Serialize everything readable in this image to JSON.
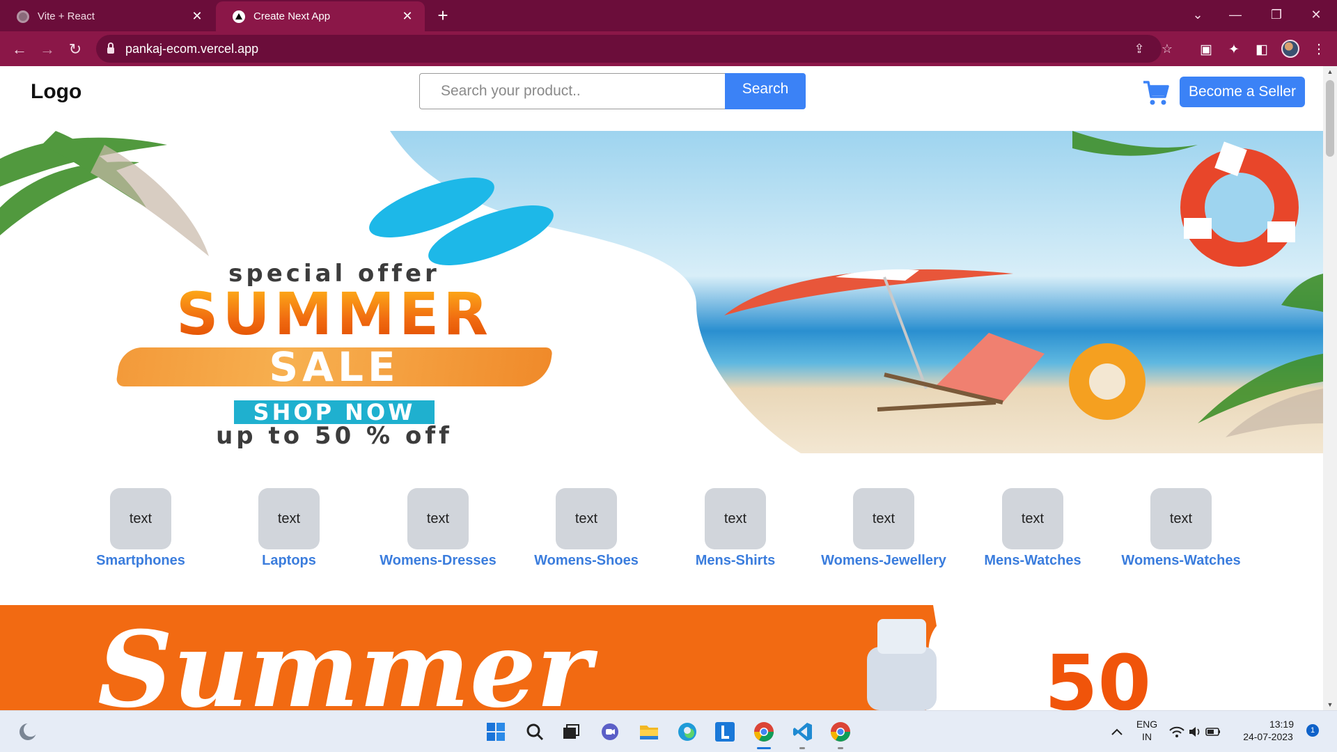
{
  "browser": {
    "tabs": [
      {
        "title": "Vite + React",
        "active": false
      },
      {
        "title": "Create Next App",
        "active": true
      }
    ],
    "url": "pankaj-ecom.vercel.app",
    "accent": "#8b1748"
  },
  "site": {
    "logo": "Logo",
    "search": {
      "placeholder": "Search your product..",
      "value": "",
      "button": "Search"
    },
    "seller_button": "Become a Seller",
    "hero": {
      "line1": "special offer",
      "line2": "SUMMER",
      "line3": "SALE",
      "cta": "SHOP NOW",
      "line4": "up to 50 % off"
    },
    "categories": [
      {
        "box": "text",
        "label": "Smartphones"
      },
      {
        "box": "text",
        "label": "Laptops"
      },
      {
        "box": "text",
        "label": "Womens-Dresses"
      },
      {
        "box": "text",
        "label": "Womens-Shoes"
      },
      {
        "box": "text",
        "label": "Mens-Shirts"
      },
      {
        "box": "text",
        "label": "Womens-Jewellery"
      },
      {
        "box": "text",
        "label": "Mens-Watches"
      },
      {
        "box": "text",
        "label": "Womens-Watches"
      }
    ],
    "banner2": {
      "script": "Summer",
      "number": "50"
    },
    "colors": {
      "primary": "#3b82f6",
      "category_label": "#3b7ddd",
      "banner2": "#f26a12"
    }
  },
  "taskbar": {
    "language": "ENG",
    "region": "IN",
    "time": "13:19",
    "date": "24-07-2023",
    "notifications": "1"
  }
}
